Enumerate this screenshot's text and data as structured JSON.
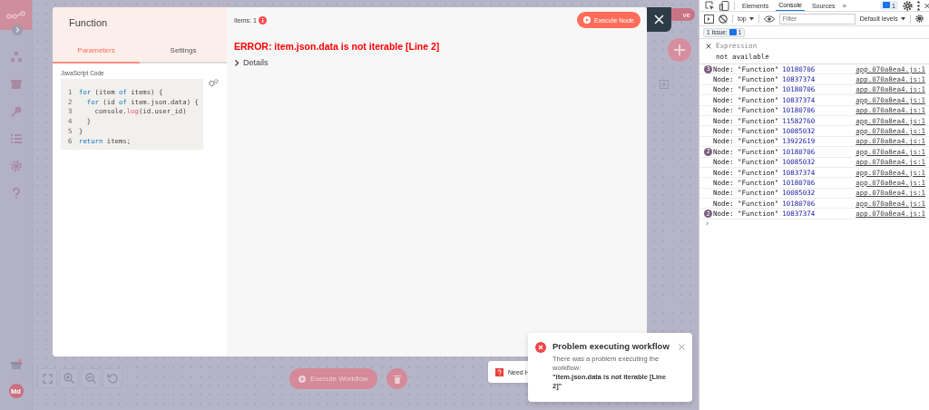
{
  "canvas": {
    "save_button_fragment": "ve",
    "execute_workflow": "Execute Workflow"
  },
  "sidebar": {
    "avatar": "Md"
  },
  "node_modal": {
    "title": "Function",
    "tabs": [
      {
        "label": "Parameters",
        "selected": true
      },
      {
        "label": "Settings",
        "selected": false
      }
    ],
    "code_label": "JavaScript Code",
    "code_lines": [
      {
        "number": "1",
        "tokens": [
          {
            "kind": "keyword",
            "text": "for"
          },
          {
            "kind": "plain",
            "text": " (item "
          },
          {
            "kind": "keyword",
            "text": "of"
          },
          {
            "kind": "plain",
            "text": " items) {"
          }
        ]
      },
      {
        "number": "2",
        "tokens": [
          {
            "kind": "keyword",
            "text": "  for"
          },
          {
            "kind": "plain",
            "text": " (id "
          },
          {
            "kind": "keyword",
            "text": "of"
          },
          {
            "kind": "plain",
            "text": " item.json.data) {"
          }
        ]
      },
      {
        "number": "3",
        "tokens": [
          {
            "kind": "plain",
            "text": "    console."
          },
          {
            "kind": "function",
            "text": "log"
          },
          {
            "kind": "plain",
            "text": "(id.user_id)"
          }
        ]
      },
      {
        "number": "4",
        "tokens": [
          {
            "kind": "plain",
            "text": "  }"
          }
        ]
      },
      {
        "number": "5",
        "tokens": [
          {
            "kind": "plain",
            "text": "}"
          }
        ]
      },
      {
        "number": "6",
        "tokens": [
          {
            "kind": "keyword",
            "text": "return"
          },
          {
            "kind": "plain",
            "text": " items;"
          }
        ]
      }
    ],
    "items_label": "Items: 1",
    "execute_node": "Execute Node",
    "error": "ERROR: item.json.data is not iterable [Line 2]",
    "details": {
      "label": "Details",
      "expanded": false
    }
  },
  "help_toast": {
    "text": "Need H"
  },
  "error_toast": {
    "title": "Problem executing workflow",
    "message": "There was a problem executing the workflow:",
    "detail": "\"item.json.data is not iterable [Line 2]\""
  },
  "devtools": {
    "tabs": [
      {
        "label": "Elements",
        "selected": false
      },
      {
        "label": "Console",
        "selected": true
      },
      {
        "label": "Sources",
        "selected": false
      }
    ],
    "more": "»",
    "issue_badge": "1",
    "context": "top",
    "filter_placeholder": "Filter",
    "levels": "Default levels",
    "issues": {
      "label": "1 Issue:",
      "count": "1"
    },
    "expression": {
      "label": "Expression",
      "value": "not available"
    },
    "logs": [
      {
        "badge": "3",
        "text": "Node: \"Function\"",
        "value": "10180706",
        "source": "app.070a8ea4.js:1"
      },
      {
        "text": "Node: \"Function\"",
        "value": "10837374",
        "source": "app.070a8ea4.js:1"
      },
      {
        "text": "Node: \"Function\"",
        "value": "10180706",
        "source": "app.070a8ea4.js:1"
      },
      {
        "text": "Node: \"Function\"",
        "value": "10837374",
        "source": "app.070a8ea4.js:1"
      },
      {
        "text": "Node: \"Function\"",
        "value": "10180706",
        "source": "app.070a8ea4.js:1"
      },
      {
        "text": "Node: \"Function\"",
        "value": "11582760",
        "source": "app.070a8ea4.js:1"
      },
      {
        "text": "Node: \"Function\"",
        "value": "10085032",
        "source": "app.070a8ea4.js:1"
      },
      {
        "text": "Node: \"Function\"",
        "value": "13922619",
        "source": "app.070a8ea4.js:1"
      },
      {
        "badge": "2",
        "text": "Node: \"Function\"",
        "value": "10180706",
        "source": "app.070a8ea4.js:1"
      },
      {
        "text": "Node: \"Function\"",
        "value": "10085032",
        "source": "app.070a8ea4.js:1"
      },
      {
        "text": "Node: \"Function\"",
        "value": "10837374",
        "source": "app.070a8ea4.js:1"
      },
      {
        "text": "Node: \"Function\"",
        "value": "10180706",
        "source": "app.070a8ea4.js:1"
      },
      {
        "text": "Node: \"Function\"",
        "value": "10085032",
        "source": "app.070a8ea4.js:1"
      },
      {
        "text": "Node: \"Function\"",
        "value": "10180706",
        "source": "app.070a8ea4.js:1"
      },
      {
        "badge": "2",
        "text": "Node: \"Function\"",
        "value": "10837374",
        "source": "app.070a8ea4.js:1"
      }
    ],
    "prompt": "›"
  }
}
